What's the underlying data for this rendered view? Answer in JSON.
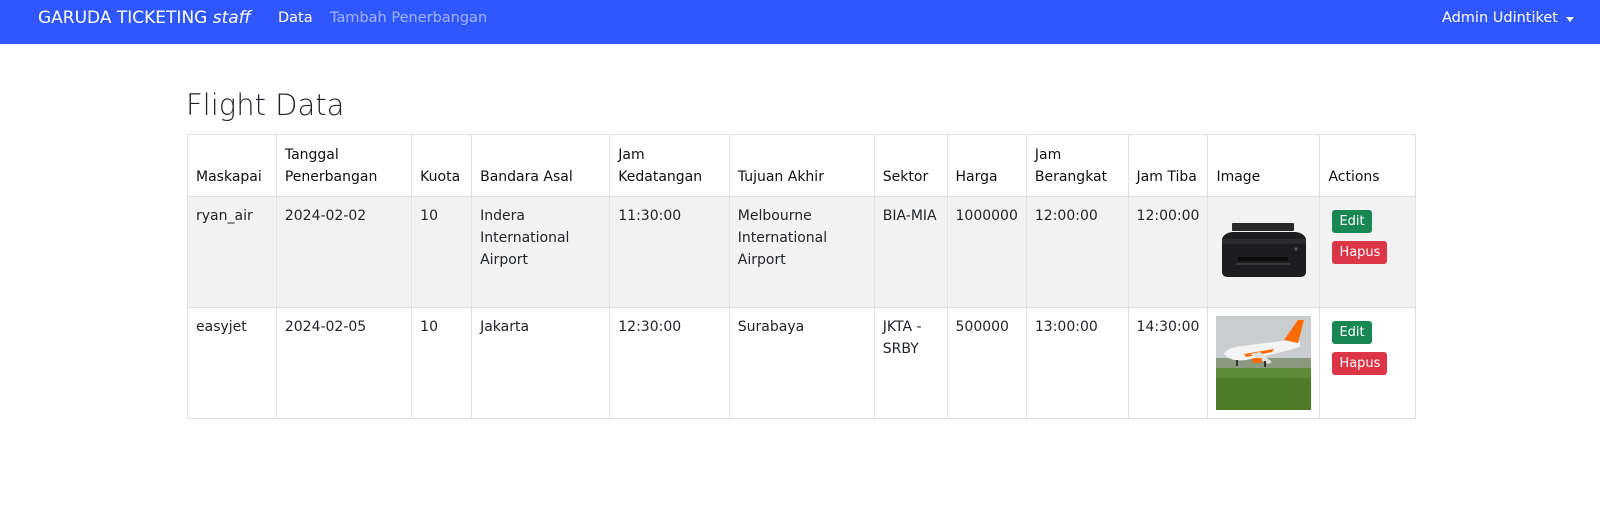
{
  "navbar": {
    "brand_main": "GARUDA TICKETING",
    "brand_suffix": "staff",
    "links": [
      {
        "label": "Data"
      },
      {
        "label": "Tambah Penerbangan"
      }
    ],
    "user": "Admin Udintiket"
  },
  "page": {
    "title": "Flight Data"
  },
  "table": {
    "headers": [
      "Maskapai",
      "Tanggal Penerbangan",
      "Kuota",
      "Bandara Asal",
      "Jam Kedatangan",
      "Tujuan Akhir",
      "Sektor",
      "Harga",
      "Jam Berangkat",
      "Jam Tiba",
      "Image",
      "Actions"
    ],
    "rows": [
      {
        "maskapai": "ryan_air",
        "tanggal": "2024-02-02",
        "kuota": "10",
        "asal": "Indera International Airport",
        "kedatangan": "11:30:00",
        "tujuan": "Melbourne International Airport",
        "sektor": "BIA-MIA",
        "harga": "1000000",
        "berangkat": "12:00:00",
        "tiba": "12:00:00",
        "image_icon": "printer-image",
        "edit": "Edit",
        "hapus": "Hapus"
      },
      {
        "maskapai": "easyjet",
        "tanggal": "2024-02-05",
        "kuota": "10",
        "asal": "Jakarta",
        "kedatangan": "12:30:00",
        "tujuan": "Surabaya",
        "sektor": "JKTA - SRBY",
        "harga": "500000",
        "berangkat": "13:00:00",
        "tiba": "14:30:00",
        "image_icon": "airplane-image",
        "edit": "Edit",
        "hapus": "Hapus"
      }
    ]
  },
  "colors": {
    "navbar": "#2f57fd",
    "edit_button": "#198754",
    "delete_button": "#dc3545"
  }
}
